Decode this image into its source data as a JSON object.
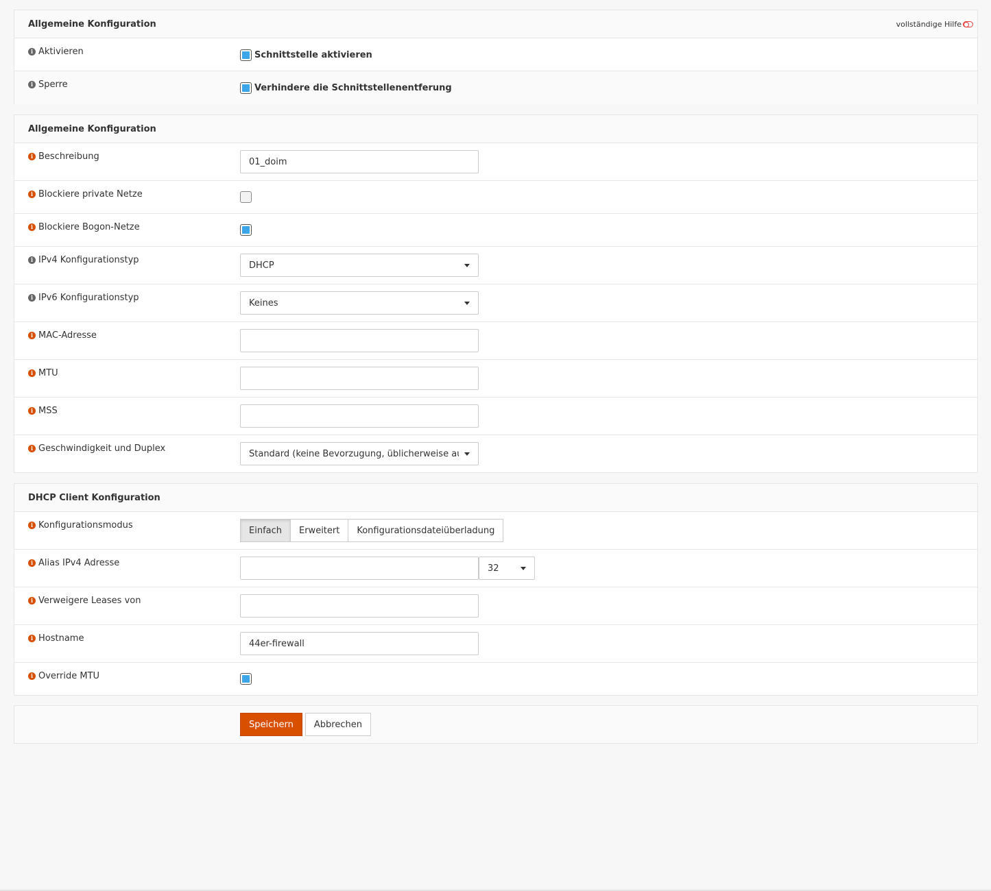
{
  "panel1": {
    "title": "Allgemeine Konfiguration",
    "help_label": "vollständige Hilfe",
    "rows": [
      {
        "label": "Aktivieren",
        "checkbox_label": "Schnittstelle aktivieren",
        "checked": true
      },
      {
        "label": "Sperre",
        "checkbox_label": "Verhindere die Schnittstellenentferung",
        "checked": true
      }
    ]
  },
  "panel2": {
    "title": "Allgemeine Konfiguration",
    "beschreibung": {
      "label": "Beschreibung",
      "value": "01_doim"
    },
    "block_private": {
      "label": "Blockiere private Netze",
      "checked": false
    },
    "block_bogon": {
      "label": "Blockiere Bogon-Netze",
      "checked": true
    },
    "ipv4_type": {
      "label": "IPv4 Konfigurationstyp",
      "value": "DHCP"
    },
    "ipv6_type": {
      "label": "IPv6 Konfigurationstyp",
      "value": "Keines"
    },
    "mac": {
      "label": "MAC-Adresse",
      "value": ""
    },
    "mtu": {
      "label": "MTU",
      "value": ""
    },
    "mss": {
      "label": "MSS",
      "value": ""
    },
    "speed": {
      "label": "Geschwindigkeit und Duplex",
      "value": "Standard (keine Bevorzugung, üblicherweise automatisch)"
    }
  },
  "panel3": {
    "title": "DHCP Client Konfiguration",
    "mode": {
      "label": "Konfigurationsmodus",
      "options": [
        "Einfach",
        "Erweitert",
        "Konfigurationsdateiüberladung"
      ],
      "selected": "Einfach"
    },
    "alias": {
      "label": "Alias IPv4 Adresse",
      "value": "",
      "subnet": "32"
    },
    "reject": {
      "label": "Verweigere Leases von",
      "value": ""
    },
    "hostname": {
      "label": "Hostname",
      "value": "44er-firewall"
    },
    "override_mtu": {
      "label": "Override MTU",
      "checked": true
    }
  },
  "actions": {
    "save_label": "Speichern",
    "cancel_label": "Abbrechen"
  },
  "colors": {
    "accent": "#d94f00",
    "checkbox_fill": "#3da6e8",
    "info_gray": "#666666",
    "info_orange": "#d94f00"
  }
}
